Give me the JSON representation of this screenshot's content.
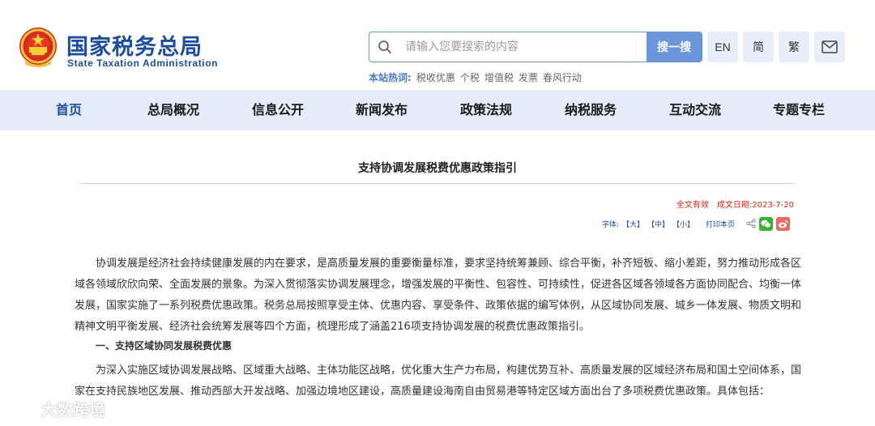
{
  "header": {
    "logo_cn": "国家税务总局",
    "logo_en": "State Taxation Administration",
    "search_placeholder": "请输入您要搜索的内容",
    "search_button": "搜一搜",
    "lang_en": "EN",
    "lang_simplified": "简",
    "lang_traditional": "繁",
    "mail_icon": "mail-icon"
  },
  "hotwords": {
    "title": "本站热词:",
    "items": [
      "税收优惠",
      "个税",
      "增值税",
      "发票",
      "春风行动"
    ]
  },
  "nav": {
    "items": [
      "首页",
      "总局概况",
      "信息公开",
      "新闻发布",
      "政策法规",
      "纳税服务",
      "互动交流",
      "专题专栏"
    ]
  },
  "article": {
    "title": "支持协调发展税费优惠政策指引",
    "validity": "全文有效",
    "date": "成文日期:2023-7-20",
    "font_label": "字体:",
    "font_large": "【大】",
    "font_medium": "【中】",
    "font_small": "【小】",
    "print_label": "打印本页",
    "para1": "协调发展是经济社会持续健康发展的内在要求，是高质量发展的重要衡量标准，要求坚持统筹兼顾、综合平衡，补齐短板、缩小差距，努力推动形成各区域各领域欣欣向荣、全面发展的景象。为深入贯彻落实协调发展理念，增强发展的平衡性、包容性、可持续性，促进各区域各领域各方面协同配合、均衡一体发展，国家实施了一系列税费优惠政策。税务总局按照享受主体、优惠内容、享受条件、政策依据的编写体例，从区域协同发展、城乡一体发展、物质文明和精神文明平衡发展、经济社会统筹发展等四个方面，梳理形成了涵盖216项支持协调发展的税费优惠政策指引。",
    "section1": "一、支持区域协同发展税费优惠",
    "para2": "为深入实施区域协调发展战略、区域重大战略、主体功能区战略，优化重大生产力布局，构建优势互补、高质量发展的区域经济布局和国土空间体系，国家在支持民族地区发展、推动西部大开发战略、加强边境地区建设，高质量建设海南自由贸易港等特定区域方面出台了多项税费优惠政策。具体包括："
  },
  "watermark": "大数跨境",
  "colors": {
    "brand_blue": "#1c4c9c",
    "nav_bg": "#e3edf9",
    "search_blue": "#6a95d8",
    "alert_red": "#d9261c"
  }
}
